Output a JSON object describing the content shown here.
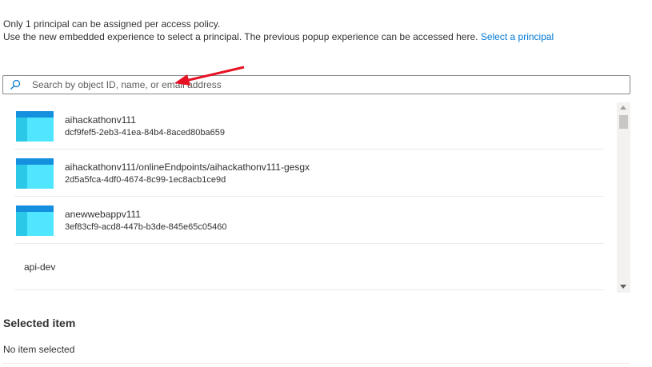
{
  "info": {
    "line1": "Only 1 principal can be assigned per access policy.",
    "line2": "Use the new embedded experience to select a principal. The previous popup experience can be accessed here.",
    "link": "Select a principal"
  },
  "search": {
    "placeholder": "Search by object ID, name, or email address",
    "value": "",
    "icon": "search-icon"
  },
  "results": [
    {
      "name": "aihackathonv111",
      "id": "dcf9fef5-2eb3-41ea-84b4-8aced80ba659",
      "icon": "app-registration-icon"
    },
    {
      "name": "aihackathonv111/onlineEndpoints/aihackathonv111-gesgx",
      "id": "2d5a5fca-4df0-4674-8c99-1ec8acb1ce9d",
      "icon": "app-registration-icon"
    },
    {
      "name": "anewwebappv111",
      "id": "3ef83cf9-acd8-447b-b3de-845e65c05460",
      "icon": "app-registration-icon"
    },
    {
      "name": "api-dev"
    }
  ],
  "selected": {
    "title": "Selected item",
    "empty": "No item selected"
  },
  "colors": {
    "accent": "#0078d4",
    "annotation_arrow": "#e81123",
    "icon_dark": "#1490df",
    "icon_light": "#50e6ff"
  }
}
